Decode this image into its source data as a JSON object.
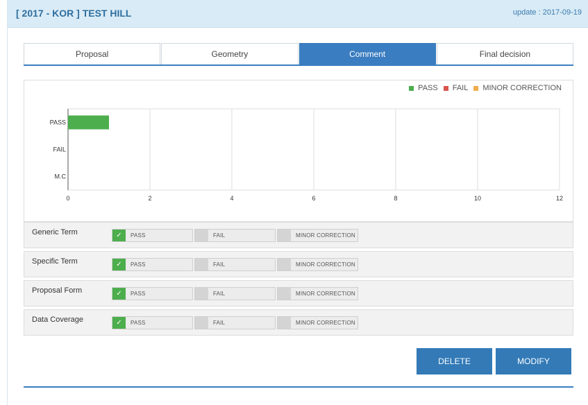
{
  "header": {
    "title": "[ 2017 - KOR ] TEST HILL",
    "update": "update : 2017-09-19"
  },
  "tabs": [
    {
      "label": "Proposal",
      "active": false
    },
    {
      "label": "Geometry",
      "active": false
    },
    {
      "label": "Comment",
      "active": true
    },
    {
      "label": "Final decision",
      "active": false
    }
  ],
  "colors": {
    "accent": "#337ab7",
    "pass": "#4cae4c",
    "fail": "#d9534f",
    "minor": "#f0ad4e"
  },
  "chart_data": {
    "type": "bar",
    "orientation": "horizontal",
    "categories": [
      "PASS",
      "FAIL",
      "M.C"
    ],
    "values": [
      1,
      0,
      0
    ],
    "xlim": [
      0,
      12
    ],
    "xticks": [
      0,
      2,
      4,
      6,
      8,
      10,
      12
    ],
    "grid": true,
    "legend_position": "top-right",
    "legend": [
      {
        "label": "PASS",
        "color": "#4cae4c"
      },
      {
        "label": "FAIL",
        "color": "#d9534f"
      },
      {
        "label": "MINOR CORRECTION",
        "color": "#f0ad4e"
      }
    ],
    "bar_colors": [
      "#4cae4c",
      "#d9534f",
      "#f0ad4e"
    ]
  },
  "review_rows": [
    {
      "label": "Generic Term",
      "selected": "pass"
    },
    {
      "label": "Specific Term",
      "selected": "pass"
    },
    {
      "label": "Proposal Form",
      "selected": "pass"
    },
    {
      "label": "Data Coverage",
      "selected": "pass"
    }
  ],
  "options": {
    "pass": "PASS",
    "fail": "FAIL",
    "minor": "MINOR CORRECTION",
    "check_glyph": "✓"
  },
  "buttons": {
    "delete": "DELETE",
    "modify": "MODIFY"
  }
}
